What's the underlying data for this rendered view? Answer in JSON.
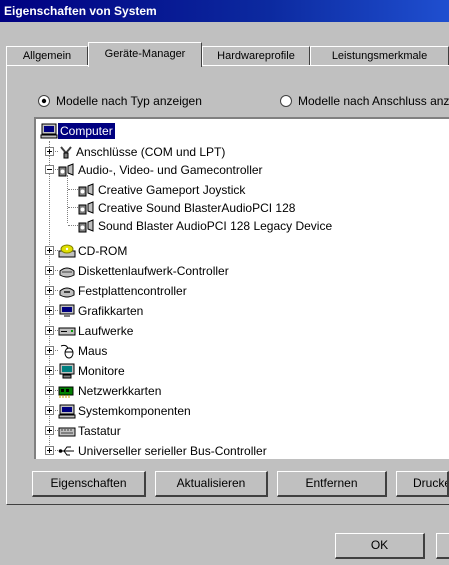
{
  "window": {
    "title": "Eigenschaften von System"
  },
  "tabs": [
    {
      "label": "Allgemein"
    },
    {
      "label": "Geräte-Manager"
    },
    {
      "label": "Hardwareprofile"
    },
    {
      "label": "Leistungsmerkmale"
    }
  ],
  "view_options": {
    "by_type": "Modelle nach Typ anzeigen",
    "by_connection": "Modelle nach Anschluss anze"
  },
  "tree": {
    "root": "Computer",
    "items": [
      "Anschlüsse (COM und LPT)",
      "Audio-, Video- und Gamecontroller",
      "Creative Gameport Joystick",
      "Creative Sound BlasterAudioPCI 128",
      "Sound Blaster AudioPCI 128 Legacy Device",
      "CD-ROM",
      "Diskettenlaufwerk-Controller",
      "Festplattencontroller",
      "Grafikkarten",
      "Laufwerke",
      "Maus",
      "Monitore",
      "Netzwerkkarten",
      "Systemkomponenten",
      "Tastatur",
      "Universeller serieller Bus-Controller"
    ]
  },
  "buttons": {
    "properties": "Eigenschaften",
    "refresh": "Aktualisieren",
    "remove": "Entfernen",
    "print": "Drucken",
    "ok": "OK"
  },
  "icons": {
    "computer": "computer-icon",
    "port": "port-icon",
    "audio": "audio-icon",
    "cdrom": "cdrom-icon",
    "floppy": "floppy-controller-icon",
    "harddisk": "harddisk-controller-icon",
    "display": "display-adapter-icon",
    "drive": "drive-icon",
    "mouse": "mouse-icon",
    "monitor": "monitor-icon",
    "network": "network-adapter-icon",
    "system": "system-devices-icon",
    "keyboard": "keyboard-icon",
    "usb": "usb-controller-icon"
  }
}
